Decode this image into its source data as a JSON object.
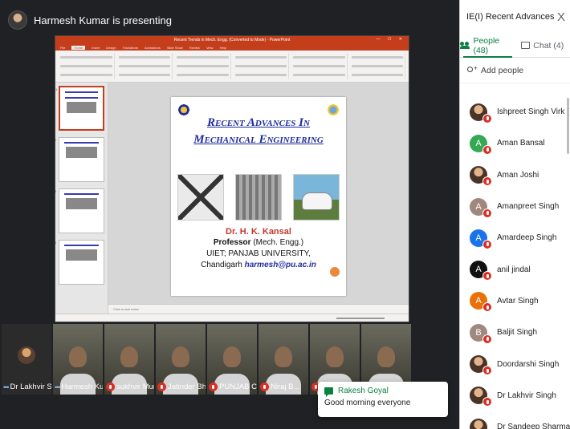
{
  "presenter": {
    "text": "Harmesh Kumar is presenting"
  },
  "ppt": {
    "title": "Recent Trends in Mech. Engg. (Converted to Mode) - PowerPoint",
    "tabs": [
      "File",
      "Home",
      "Insert",
      "Design",
      "Transitions",
      "Animations",
      "Slide Show",
      "Review",
      "View",
      "Help"
    ],
    "notes_placeholder": "Click to add notes"
  },
  "slide": {
    "title_line1": "Recent Advances In",
    "title_line2": "Mechanical Engineering",
    "name": "Dr. H. K. Kansal",
    "line1_bold": "Professor",
    "line1_rest": " (Mech. Engg.)",
    "line2": "UIET; PANJAB UNIVERSITY,",
    "line3_prefix": "Chandigarh ",
    "email": "harmesh@pu.ac.in"
  },
  "strip": [
    {
      "name": "Dr Lakhvir Sin...",
      "type": "avatar",
      "dots": true,
      "muted": false
    },
    {
      "name": "Harmesh Ku...",
      "type": "video",
      "dots": true,
      "muted": false
    },
    {
      "name": "sukhvir Mundi",
      "type": "video",
      "dots": false,
      "muted": true
    },
    {
      "name": "Jatinder Bhalla",
      "type": "video",
      "dots": false,
      "muted": true
    },
    {
      "name": "PUNJAB C...",
      "type": "video",
      "dots": false,
      "muted": true
    },
    {
      "name": "Niraj B...",
      "type": "video",
      "dots": false,
      "muted": true
    },
    {
      "name": "",
      "type": "video",
      "dots": false,
      "muted": true
    },
    {
      "name": "",
      "type": "video",
      "dots": false,
      "muted": true
    }
  ],
  "toast": {
    "sender": "Rakesh Goyal",
    "message": "Good morning everyone"
  },
  "panel": {
    "title": "IE(I) Recent Advances in Mecha...",
    "close": "X",
    "tab_people": "People (48)",
    "tab_chat": "Chat (4)",
    "add_people": "Add people"
  },
  "people": [
    {
      "name": "Ishpreet Singh Virk (You)",
      "initial": "",
      "color": "#ffffff",
      "photo": true
    },
    {
      "name": "Aman Bansal",
      "initial": "A",
      "color": "#34a853",
      "photo": false
    },
    {
      "name": "Aman Joshi",
      "initial": "",
      "color": "#ffffff",
      "photo": true
    },
    {
      "name": "Amanpreet Singh",
      "initial": "A",
      "color": "#a1887f",
      "photo": false
    },
    {
      "name": "Amardeep Singh",
      "initial": "A",
      "color": "#1a73e8",
      "photo": false
    },
    {
      "name": "anil jindal",
      "initial": "A",
      "color": "#111111",
      "photo": false
    },
    {
      "name": "Avtar Singh",
      "initial": "A",
      "color": "#e8710a",
      "photo": false
    },
    {
      "name": "Baljit Singh",
      "initial": "B",
      "color": "#a1887f",
      "photo": false
    },
    {
      "name": "Doordarshi Singh",
      "initial": "",
      "color": "#ffffff",
      "photo": true
    },
    {
      "name": "Dr Lakhvir Singh",
      "initial": "",
      "color": "#ffffff",
      "photo": true
    },
    {
      "name": "Dr Sandeep Sharma",
      "initial": "",
      "color": "#ffffff",
      "photo": true
    }
  ]
}
